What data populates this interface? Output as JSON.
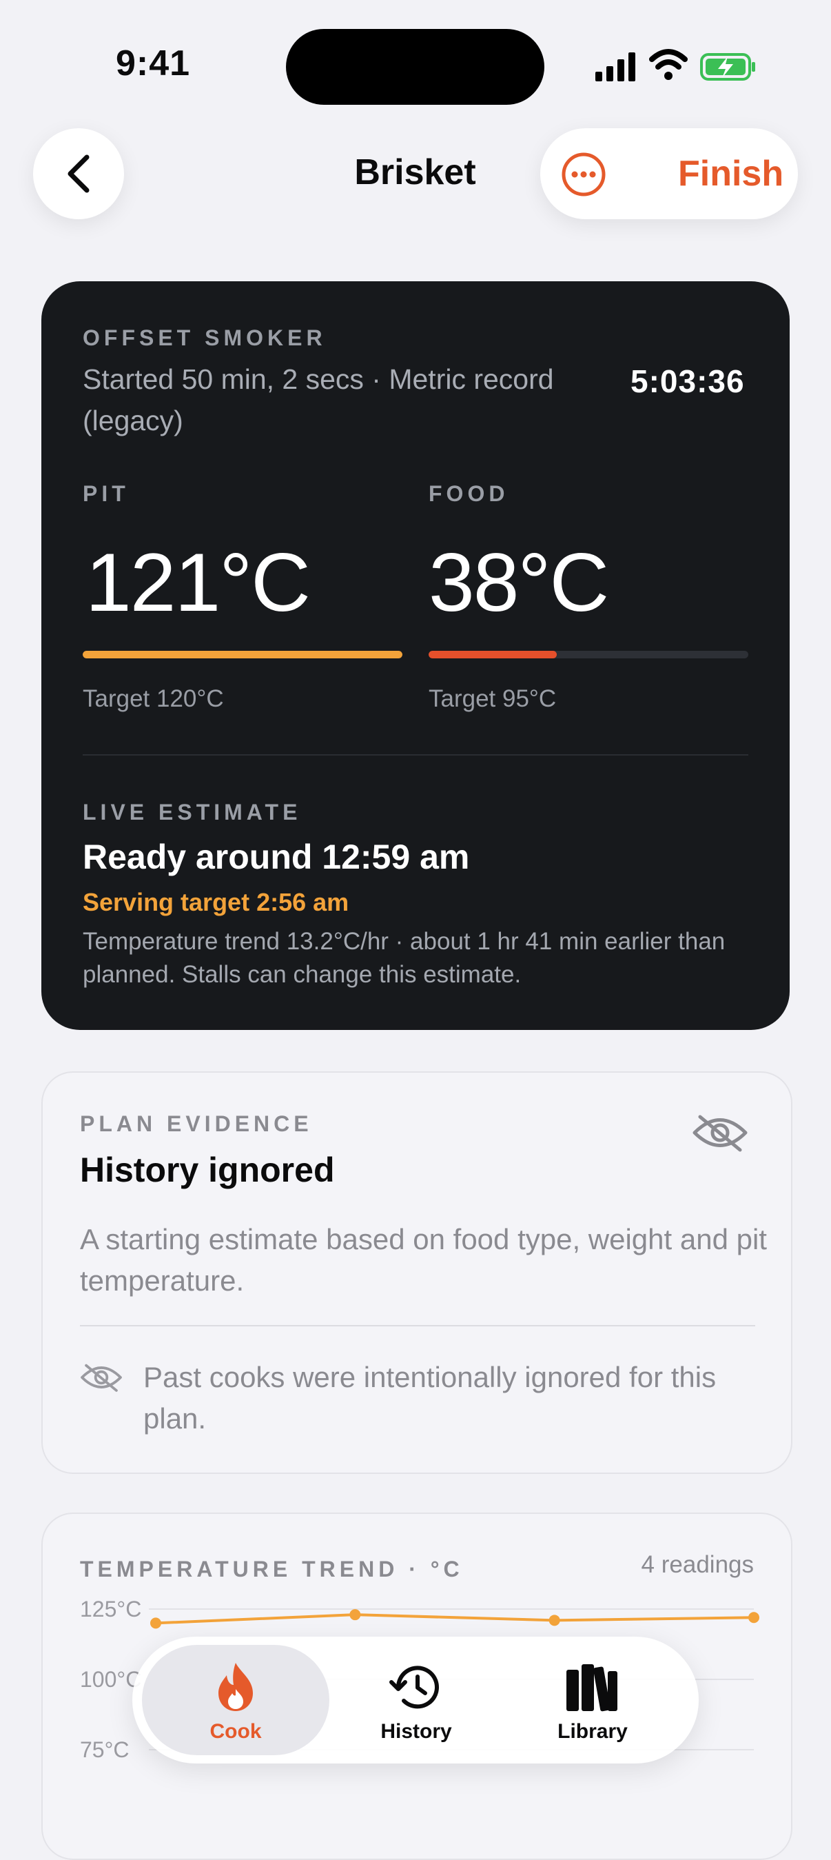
{
  "status_bar": {
    "time": "9:41"
  },
  "nav": {
    "title": "Brisket",
    "finish_label": "Finish"
  },
  "cook_card": {
    "eyebrow": "OFFSET SMOKER",
    "subtitle": "Started 50 min, 2 secs · Metric record (legacy)",
    "timer": "5:03:36",
    "pit": {
      "label": "PIT",
      "value": "121°C",
      "target": "Target 120°C",
      "progress": 1.0,
      "color": "#f3a33a"
    },
    "food": {
      "label": "FOOD",
      "value": "38°C",
      "target": "Target 95°C",
      "progress": 0.4,
      "color": "#e5502b"
    },
    "estimate": {
      "label": "LIVE ESTIMATE",
      "ready": "Ready around 12:59 am",
      "serving": "Serving target 2:56 am",
      "note": "Temperature trend 13.2°C/hr · about 1 hr 41 min earlier than planned. Stalls can change this estimate."
    }
  },
  "plan_card": {
    "eyebrow": "PLAN EVIDENCE",
    "title": "History ignored",
    "description": "A starting estimate based on food type, weight and pit temperature.",
    "note": "Past cooks were intentionally ignored for this plan."
  },
  "trend_card": {
    "eyebrow": "TEMPERATURE TREND · °C",
    "readings": "4 readings",
    "y_labels": [
      "125°C",
      "100°C",
      "75°C"
    ]
  },
  "chart_data": {
    "type": "line",
    "title": "TEMPERATURE TREND · °C",
    "x": [
      1,
      2,
      3,
      4
    ],
    "series": [
      {
        "values": [
          120,
          123,
          121,
          122
        ],
        "color": "#f3a33a"
      }
    ],
    "ylim": [
      75,
      125
    ],
    "y_ticks": [
      "125°C",
      "100°C",
      "75°C"
    ],
    "grid": true
  },
  "tabbar": {
    "tabs": [
      {
        "label": "Cook",
        "icon": "flame-icon",
        "active": true
      },
      {
        "label": "History",
        "icon": "clock-history-icon",
        "active": false
      },
      {
        "label": "Library",
        "icon": "books-icon",
        "active": false
      }
    ]
  },
  "colors": {
    "accent": "#e55a2b",
    "pit": "#f3a33a",
    "food": "#e5502b",
    "dark_card": "#17191c"
  }
}
